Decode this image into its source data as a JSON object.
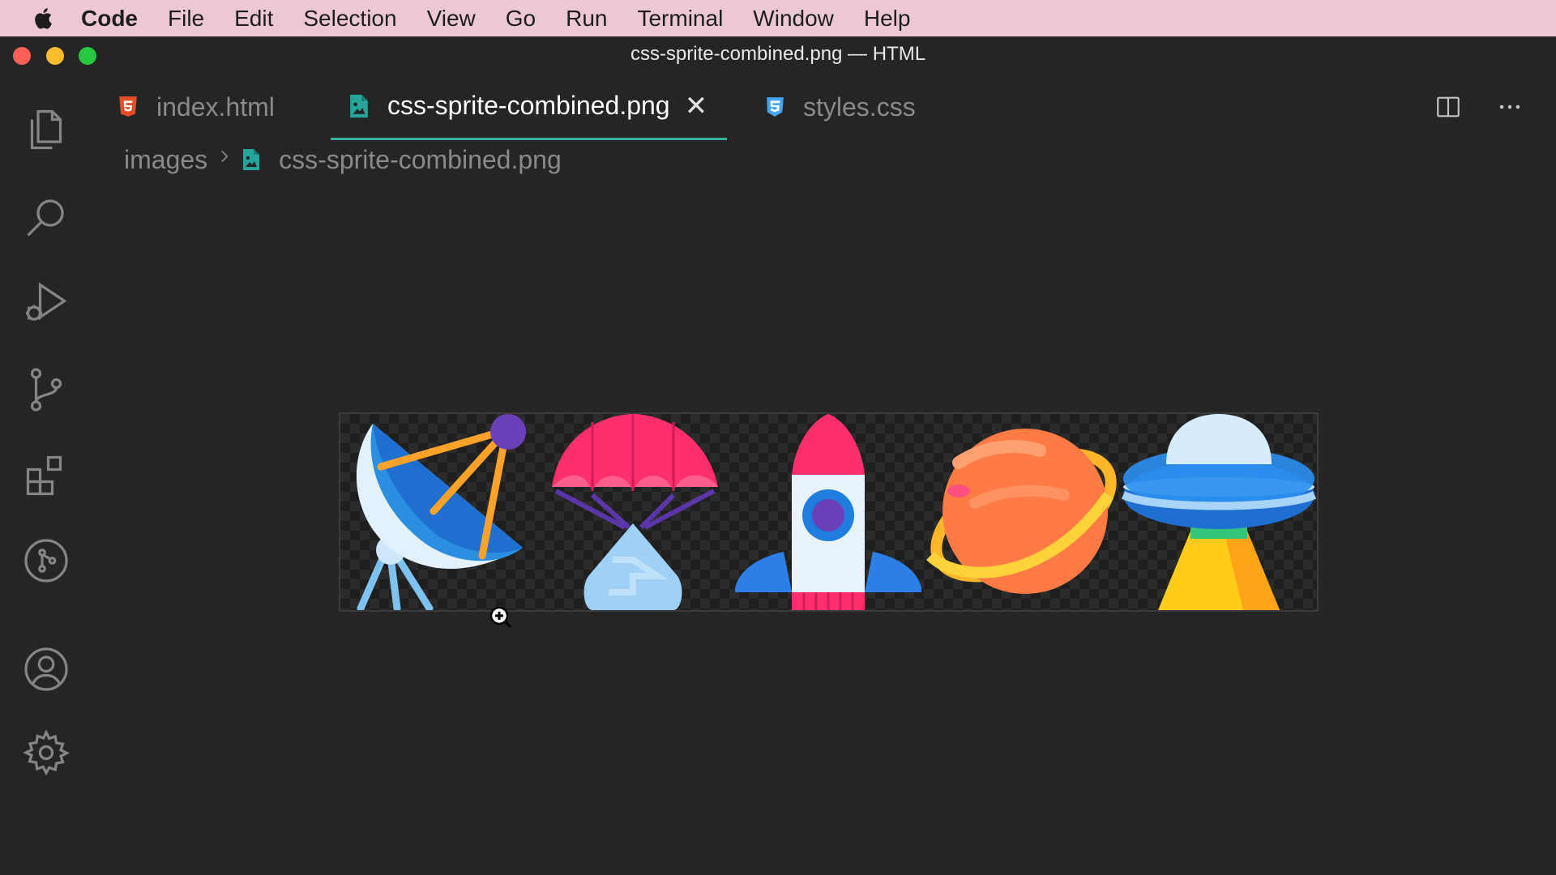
{
  "menubar": {
    "app": "Code",
    "items": [
      "File",
      "Edit",
      "Selection",
      "View",
      "Go",
      "Run",
      "Terminal",
      "Window",
      "Help"
    ]
  },
  "window": {
    "title": "css-sprite-combined.png — HTML"
  },
  "activity_bar": {
    "icons": [
      "explorer-icon",
      "search-icon",
      "run-debug-icon",
      "source-control-icon",
      "extensions-icon",
      "git-graph-icon",
      "account-icon",
      "settings-gear-icon"
    ]
  },
  "tabs": [
    {
      "label": "index.html",
      "icon": "html5-icon",
      "active": false
    },
    {
      "label": "css-sprite-combined.png",
      "icon": "image-file-icon",
      "active": true,
      "close": "✕"
    },
    {
      "label": "styles.css",
      "icon": "css3-icon",
      "active": false
    }
  ],
  "breadcrumb": {
    "folder": "images",
    "separator": ">",
    "file": "css-sprite-combined.png"
  },
  "preview": {
    "sprites": [
      "satellite-dish",
      "parachute-capsule",
      "rocket",
      "planet",
      "ufo"
    ]
  },
  "colors": {
    "menubar_bg": "#ecc8d6",
    "editor_bg": "#252526",
    "active_tab_border": "#39b0a0",
    "html_icon": "#e44d26",
    "css_icon": "#42a5f5",
    "image_icon": "#26a69a"
  }
}
